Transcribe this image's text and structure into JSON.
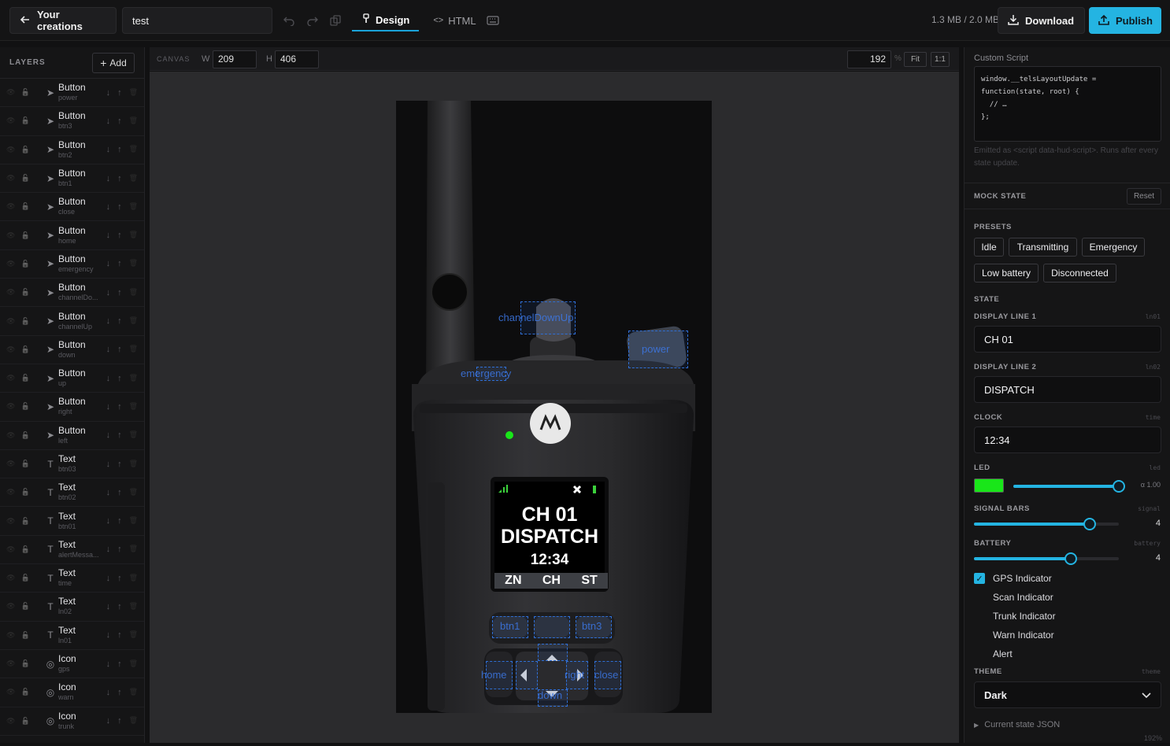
{
  "topbar": {
    "back_label": "Your creations",
    "project_name": "test",
    "tabs": [
      {
        "label": "Design",
        "active": true
      },
      {
        "label": "HTML",
        "active": false
      }
    ],
    "size_info": "1.3 MB / 2.0 MB",
    "download_label": "Download",
    "publish_label": "Publish"
  },
  "layers": {
    "title": "LAYERS",
    "add_label": "Add",
    "items": [
      {
        "type": "Button",
        "id": "power"
      },
      {
        "type": "Button",
        "id": "btn3"
      },
      {
        "type": "Button",
        "id": "btn2"
      },
      {
        "type": "Button",
        "id": "btn1"
      },
      {
        "type": "Button",
        "id": "close"
      },
      {
        "type": "Button",
        "id": "home"
      },
      {
        "type": "Button",
        "id": "emergency"
      },
      {
        "type": "Button",
        "id": "channelDo..."
      },
      {
        "type": "Button",
        "id": "channelUp"
      },
      {
        "type": "Button",
        "id": "down"
      },
      {
        "type": "Button",
        "id": "up"
      },
      {
        "type": "Button",
        "id": "right"
      },
      {
        "type": "Button",
        "id": "left"
      },
      {
        "type": "Text",
        "id": "btn03"
      },
      {
        "type": "Text",
        "id": "btn02"
      },
      {
        "type": "Text",
        "id": "btn01"
      },
      {
        "type": "Text",
        "id": "alertMessa..."
      },
      {
        "type": "Text",
        "id": "time"
      },
      {
        "type": "Text",
        "id": "ln02"
      },
      {
        "type": "Text",
        "id": "ln01"
      },
      {
        "type": "Icon",
        "id": "gps"
      },
      {
        "type": "Icon",
        "id": "warn"
      },
      {
        "type": "Icon",
        "id": "trunk"
      }
    ]
  },
  "canvas": {
    "label": "CANVAS",
    "w_label": "W",
    "width": "209",
    "h_label": "H",
    "height": "406",
    "zoom": "192",
    "zoom_unit": "%",
    "fit_label": "Fit",
    "one_label": "1:1"
  },
  "device": {
    "line1": "CH 01",
    "line2": "DISPATCH",
    "time": "12:34",
    "softkeys": [
      "ZN",
      "CH",
      "ST"
    ],
    "overlay_labels": {
      "channel": "channelDownUp",
      "power": "power",
      "emergency": "emergency",
      "btn1": "btn1",
      "btn3": "btn3",
      "left": "home",
      "right": "right",
      "close": "close",
      "down": "down"
    }
  },
  "props": {
    "script_title": "Custom Script",
    "script_code": "window.__telsLayoutUpdate =\nfunction(state, root) {\n  // …\n};",
    "script_note": "Emitted as <script data-hud-script>. Runs after every state update.",
    "mock_state": "MOCK STATE",
    "reset_label": "Reset",
    "presets_label": "PRESETS",
    "presets": [
      "Idle",
      "Transmitting",
      "Emergency",
      "Low battery",
      "Disconnected"
    ],
    "state_label": "STATE",
    "display1": {
      "label": "DISPLAY LINE 1",
      "hint": "ln01",
      "value": "CH 01"
    },
    "display2": {
      "label": "DISPLAY LINE 2",
      "hint": "ln02",
      "value": "DISPATCH"
    },
    "clock": {
      "label": "CLOCK",
      "hint": "time",
      "value": "12:34"
    },
    "led": {
      "label": "LED",
      "hint": "led",
      "color": "#19e619",
      "alpha_label": "α 1.00",
      "alpha": 1.0
    },
    "signal": {
      "label": "SIGNAL BARS",
      "hint": "signal",
      "value": "4",
      "fraction": 0.8
    },
    "battery": {
      "label": "BATTERY",
      "hint": "battery",
      "value": "4",
      "fraction": 0.67
    },
    "checks": [
      {
        "label": "GPS Indicator",
        "checked": true
      },
      {
        "label": "Scan Indicator",
        "checked": false
      },
      {
        "label": "Trunk Indicator",
        "checked": false
      },
      {
        "label": "Warn Indicator",
        "checked": false
      },
      {
        "label": "Alert",
        "checked": false
      }
    ],
    "theme": {
      "label": "THEME",
      "hint": "theme",
      "value": "Dark"
    },
    "state_json_label": "Current state JSON",
    "corner_zoom": "192%"
  }
}
